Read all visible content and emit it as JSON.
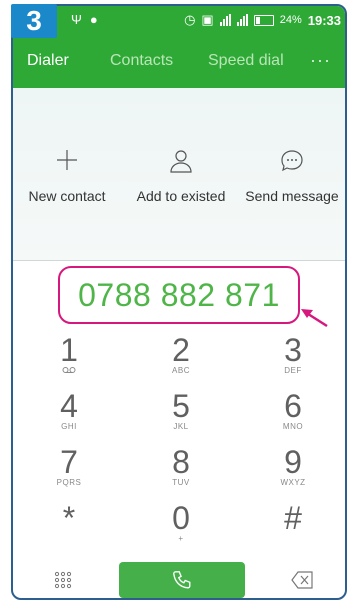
{
  "step_number": "3",
  "status_bar": {
    "battery": "24%",
    "time": "19:33"
  },
  "tabs": [
    {
      "label": "Dialer",
      "active": true
    },
    {
      "label": "Contacts",
      "active": false
    },
    {
      "label": "Speed dial",
      "active": false
    }
  ],
  "more_menu": "···",
  "actions": {
    "new_contact": {
      "label": "New contact",
      "icon": "plus-icon"
    },
    "add_to_existed": {
      "label": "Add to existed",
      "icon": "person-icon"
    },
    "send_message": {
      "label": "Send message",
      "icon": "message-icon"
    }
  },
  "dialed_number": "0788 882 871",
  "keys": [
    {
      "digit": "1",
      "sub": "voicemail"
    },
    {
      "digit": "2",
      "sub": "ABC"
    },
    {
      "digit": "3",
      "sub": "DEF"
    },
    {
      "digit": "4",
      "sub": "GHI"
    },
    {
      "digit": "5",
      "sub": "JKL"
    },
    {
      "digit": "6",
      "sub": "MNO"
    },
    {
      "digit": "7",
      "sub": "PQRS"
    },
    {
      "digit": "8",
      "sub": "TUV"
    },
    {
      "digit": "9",
      "sub": "WXYZ"
    },
    {
      "digit": "*",
      "sub": ""
    },
    {
      "digit": "0",
      "sub": "+"
    },
    {
      "digit": "#",
      "sub": ""
    }
  ],
  "colors": {
    "header_green": "#2fa936",
    "number_green": "#4fb548",
    "highlight_magenta": "#d6187e",
    "badge_blue": "#1a88c9"
  }
}
